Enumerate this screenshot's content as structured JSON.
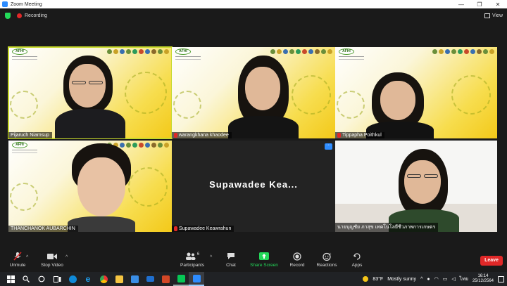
{
  "window": {
    "title": "Zoom Meeting"
  },
  "topbar": {
    "recording_label": "Recording",
    "view_label": "View"
  },
  "participants": [
    {
      "name": "Pijaruch Niamsup",
      "muted": false
    },
    {
      "name": "warangkhana khaodee",
      "muted": true
    },
    {
      "name": "Tippapha Poithkul",
      "muted": true
    },
    {
      "name": "THANCHANOK AUBARCHIN",
      "muted": false
    },
    {
      "name": "Supawadee Keawrahun",
      "muted": true,
      "display_text": "Supawadee  Kea..."
    },
    {
      "name": "นายบุญชัย ภาสุข เทคโนโลยีชีวภาพการเกษตร",
      "muted": false
    }
  ],
  "toolbar": {
    "unmute": "Unmute",
    "stop_video": "Stop Video",
    "participants": "Participants",
    "participants_count": "6",
    "chat": "Chat",
    "share_screen": "Share Screen",
    "record": "Record",
    "reactions": "Reactions",
    "apps": "Apps",
    "leave": "Leave"
  },
  "taskbar": {
    "weather_temp": "83°F",
    "weather_desc": "Mostly sunny",
    "language": "ไทย",
    "time": "16:14",
    "date": "25/12/2564"
  },
  "colors": {
    "active_speaker_border": "#c7d92b",
    "leave_red": "#e02828",
    "share_green": "#23d959",
    "zoom_blue": "#2d8cff"
  }
}
